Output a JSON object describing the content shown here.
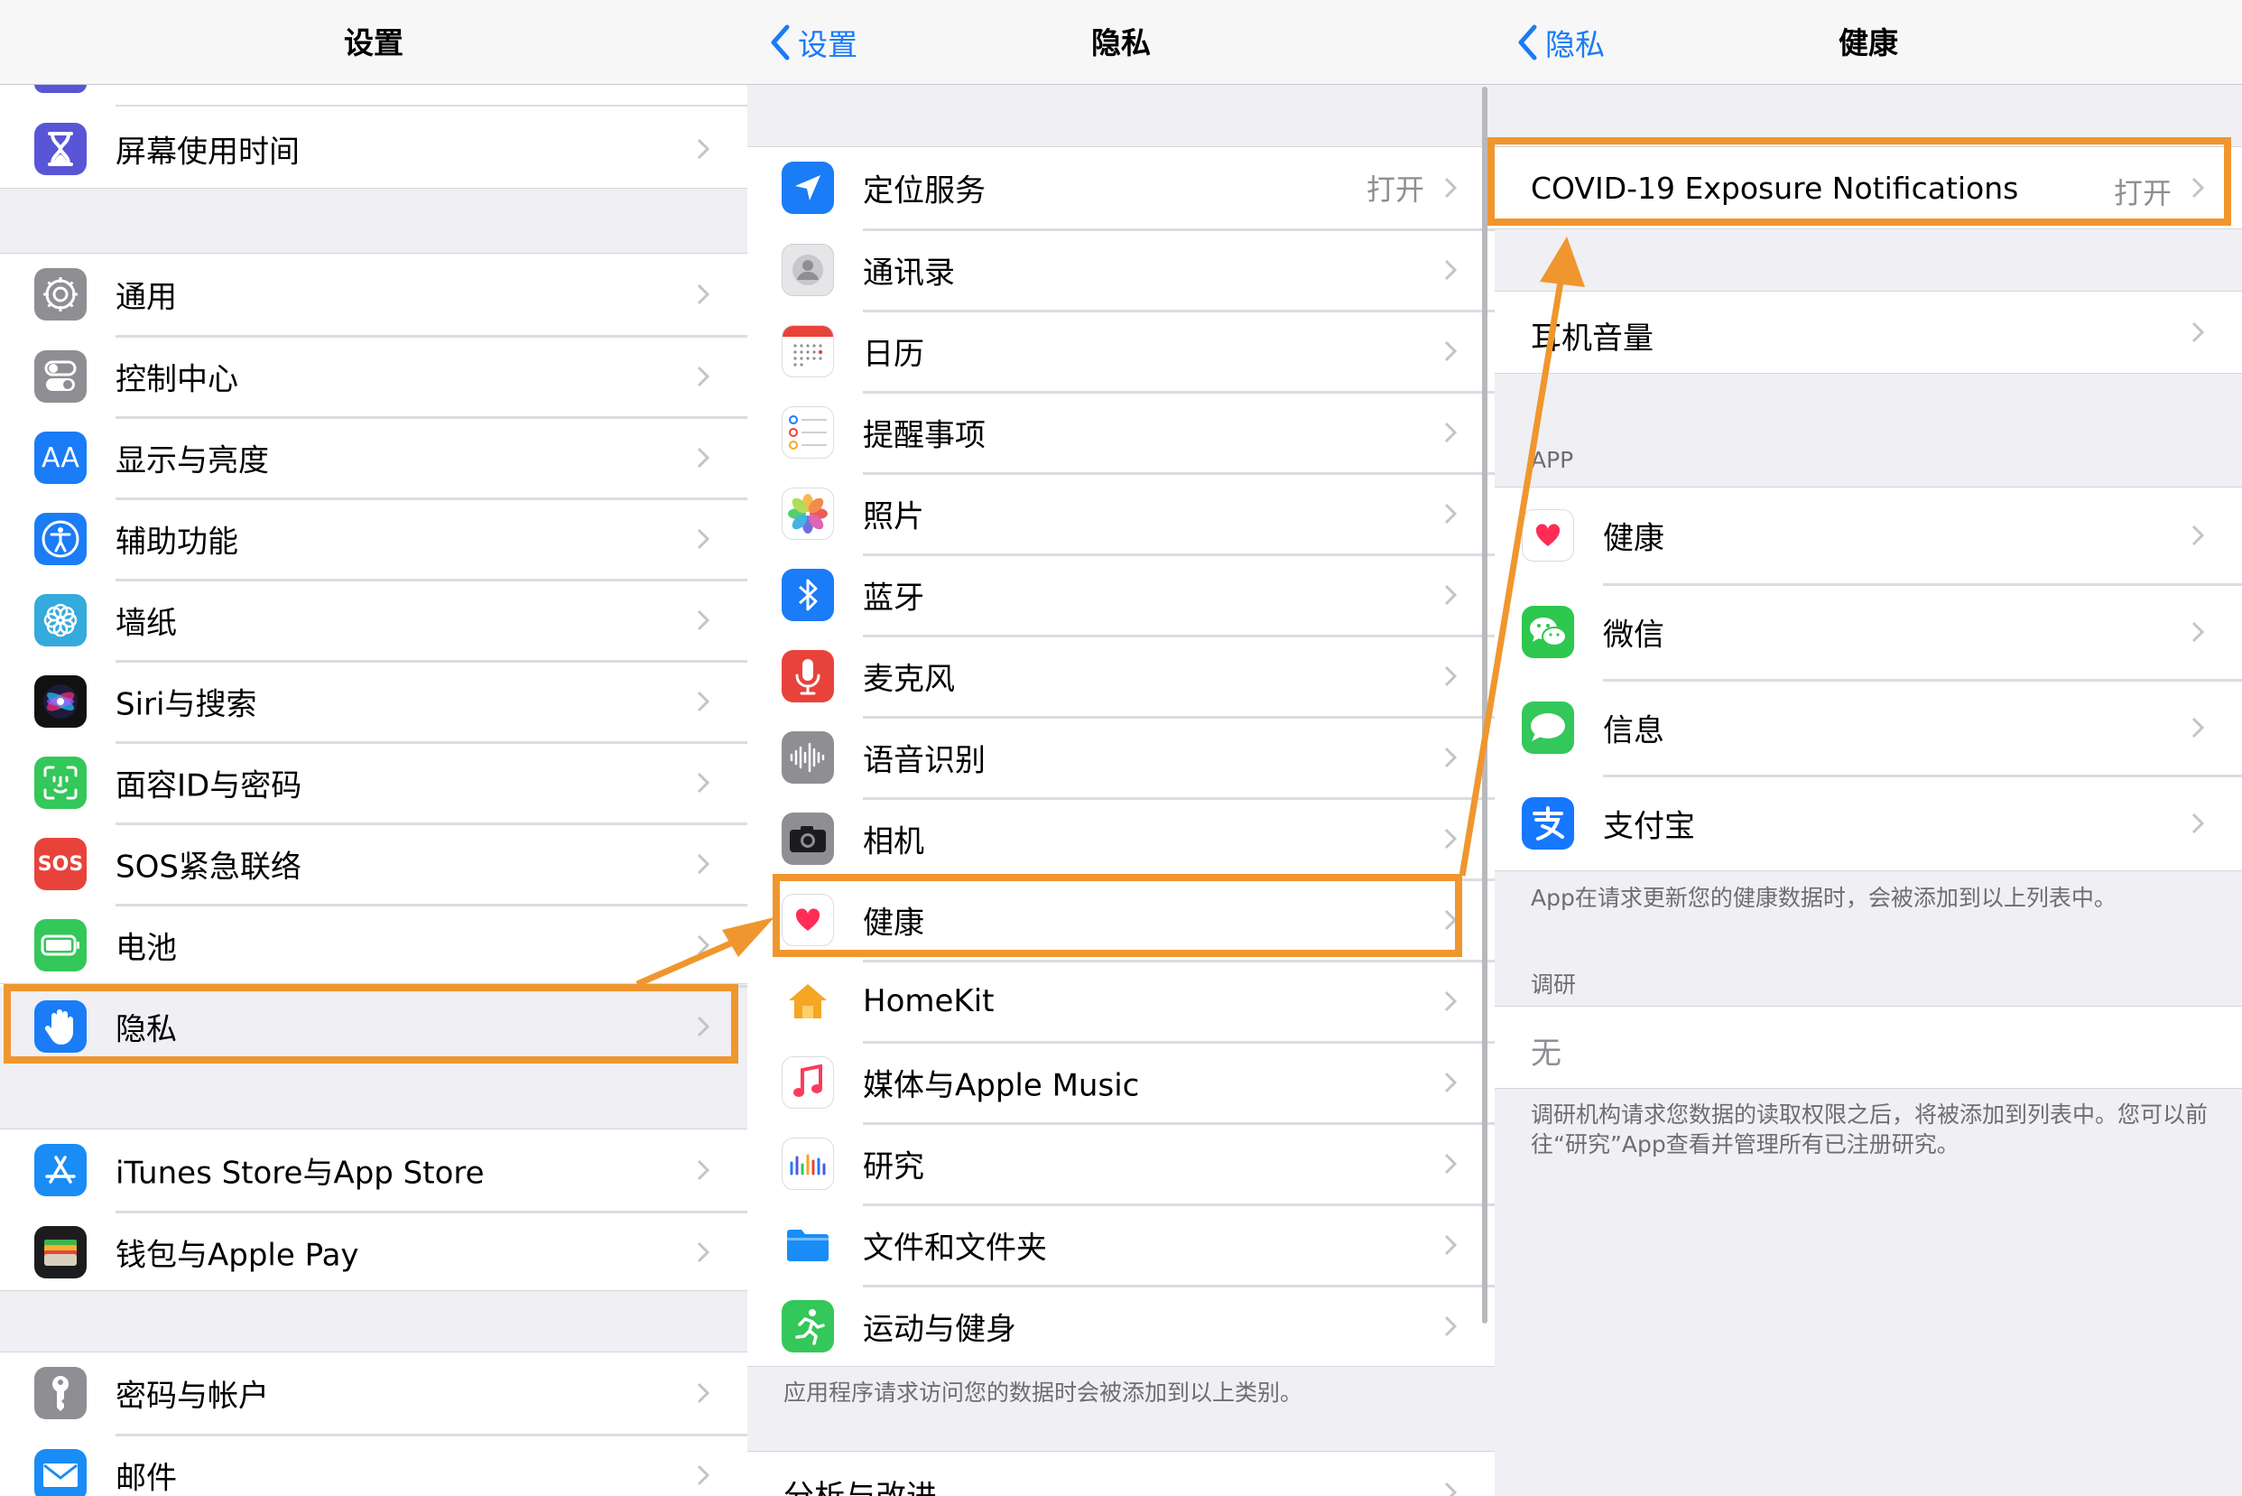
{
  "panel1": {
    "title": "设置",
    "items": {
      "screen_time": "屏幕使用时间",
      "general": "通用",
      "control_center": "控制中心",
      "display": "显示与亮度",
      "accessibility": "辅助功能",
      "wallpaper": "墙纸",
      "siri": "Siri与搜索",
      "faceid": "面容ID与密码",
      "sos": "SOS紧急联络",
      "battery": "电池",
      "privacy": "隐私",
      "itunes": "iTunes Store与App Store",
      "wallet": "钱包与Apple Pay",
      "passwords": "密码与帐户",
      "mail": "邮件"
    },
    "icon_text": {
      "display": "AA",
      "sos": "SOS"
    }
  },
  "panel2": {
    "back": "设置",
    "title": "隐私",
    "items": {
      "location": "定位服务",
      "location_value": "打开",
      "contacts": "通讯录",
      "calendar": "日历",
      "reminders": "提醒事项",
      "photos": "照片",
      "bluetooth": "蓝牙",
      "microphone": "麦克风",
      "speech": "语音识别",
      "camera": "相机",
      "health": "健康",
      "homekit": "HomeKit",
      "media": "媒体与Apple Music",
      "research": "研究",
      "files": "文件和文件夹",
      "fitness": "运动与健身",
      "analytics": "分析与改进"
    },
    "footer": "应用程序请求访问您的数据时会被添加到以上类别。"
  },
  "panel3": {
    "back": "隐私",
    "title": "健康",
    "covid": "COVID-19 Exposure Notifications",
    "covid_value": "打开",
    "headphone": "耳机音量",
    "app_header": "APP",
    "apps": {
      "health": "健康",
      "wechat": "微信",
      "messages": "信息",
      "alipay": "支付宝"
    },
    "apps_footer": "App在请求更新您的健康数据时，会被添加到以上列表中。",
    "research_header": "调研",
    "research_none": "无",
    "research_footer": "调研机构请求您数据的读取权限之后，将被添加到列表中。您可以前往“研究”App查看并管理所有已注册研究。"
  },
  "colors": {
    "highlight": "#f0962e",
    "ios_blue": "#1a7cf6"
  }
}
